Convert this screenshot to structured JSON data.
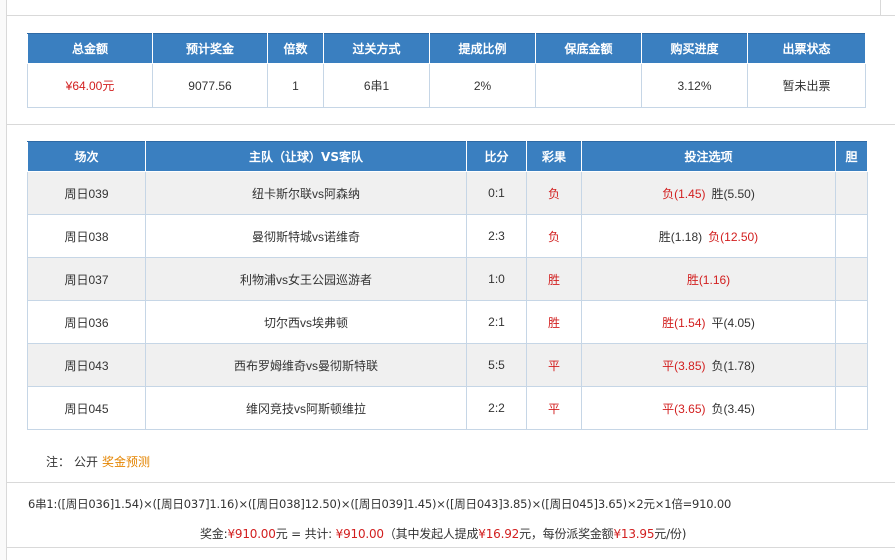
{
  "summary": {
    "headers": [
      "总金额",
      "预计奖金",
      "倍数",
      "过关方式",
      "提成比例",
      "保底金额",
      "购买进度",
      "出票状态"
    ],
    "total_amount": "¥64.00元",
    "estimated_prize": "9077.56",
    "multiple": "1",
    "pass_type": "6串1",
    "commission": "2%",
    "guarantee": "",
    "progress": "3.12%",
    "ticket_status": "暂未出票"
  },
  "matches": {
    "headers": [
      "场次",
      "主队（让球）VS客队",
      "比分",
      "彩果",
      "投注选项",
      "胆"
    ],
    "rows": [
      {
        "id": "周日039",
        "teams": "纽卡斯尔联vs阿森纳",
        "score": "0:1",
        "result": "负",
        "opt1": "负(1.45)",
        "opt2": "胜(5.50)",
        "banker": ""
      },
      {
        "id": "周日038",
        "teams": "曼彻斯特城vs诺维奇",
        "score": "2:3",
        "result": "负",
        "opt1": "胜(1.18)",
        "opt2": "负(12.50)",
        "banker": ""
      },
      {
        "id": "周日037",
        "teams": "利物浦vs女王公园巡游者",
        "score": "1:0",
        "result": "胜",
        "opt1": "胜(1.16)",
        "opt2": "",
        "banker": ""
      },
      {
        "id": "周日036",
        "teams": "切尔西vs埃弗顿",
        "score": "2:1",
        "result": "胜",
        "opt1": "胜(1.54)",
        "opt2": "平(4.05)",
        "banker": ""
      },
      {
        "id": "周日043",
        "teams": "西布罗姆维奇vs曼彻斯特联",
        "score": "5:5",
        "result": "平",
        "opt1": "平(3.85)",
        "opt2": "负(1.78)",
        "banker": ""
      },
      {
        "id": "周日045",
        "teams": "维冈竞技vs阿斯顿维拉",
        "score": "2:2",
        "result": "平",
        "opt1": "平(3.65)",
        "opt2": "负(3.45)",
        "banker": ""
      }
    ]
  },
  "note": {
    "label": "注：",
    "public": "公开",
    "link": "奖金预测"
  },
  "formula": "6串1:([周日036]1.54)×([周日037]1.16)×([周日038]12.50)×([周日039]1.45)×([周日043]3.85)×([周日045]3.65)×2元×1倍=910.00",
  "prize": {
    "label": "奖金:",
    "amount": "¥910.00",
    "unit": "元 = 共计: ",
    "total": "¥910.00",
    "mid1": "（其中发起人提成",
    "commission": "¥16.92",
    "mid2": "元，每份派奖金额",
    "per_share": "¥13.95",
    "tail": "元/份)"
  },
  "colors": {
    "header_bg": "#3a7fc0",
    "win_red": "#d21f1f",
    "link_orange": "#e48400"
  }
}
